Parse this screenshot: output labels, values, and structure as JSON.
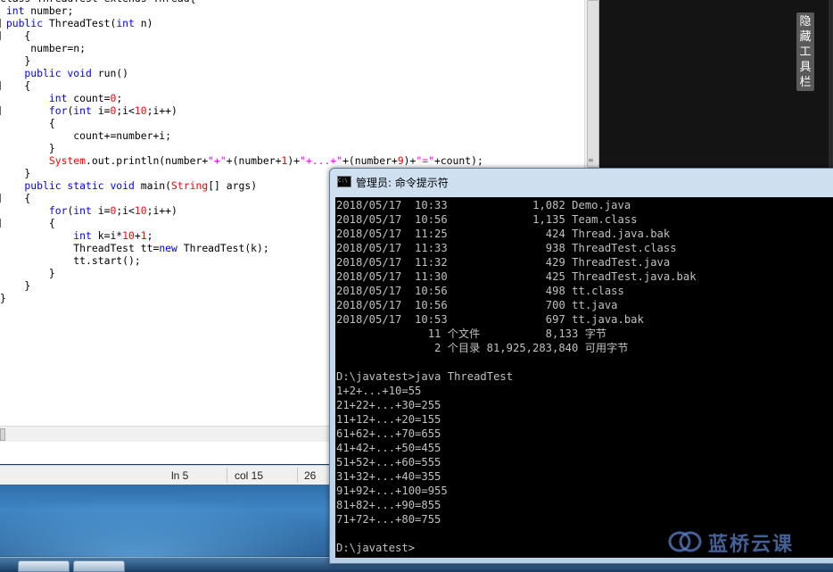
{
  "editor": {
    "lines": [
      [
        {
          "t": "class ThreadTest extends Thread{",
          "c": ""
        }
      ],
      [
        {
          "t": " int",
          "c": "kw"
        },
        {
          "t": " number;",
          "c": ""
        }
      ],
      [
        {
          "t": " public ",
          "c": "kw"
        },
        {
          "t": "ThreadTest(",
          "c": ""
        },
        {
          "t": "int",
          "c": "kw"
        },
        {
          "t": " n)",
          "c": ""
        }
      ],
      [
        {
          "t": "    {",
          "c": ""
        }
      ],
      [
        {
          "t": "     number=n;",
          "c": ""
        }
      ],
      [
        {
          "t": "    }",
          "c": ""
        }
      ],
      [
        {
          "t": "    public void ",
          "c": "kw"
        },
        {
          "t": "run()",
          "c": ""
        }
      ],
      [
        {
          "t": "    {",
          "c": ""
        }
      ],
      [
        {
          "t": "        int",
          "c": "kw"
        },
        {
          "t": " count=",
          "c": ""
        },
        {
          "t": "0",
          "c": "num"
        },
        {
          "t": ";",
          "c": ""
        }
      ],
      [
        {
          "t": "        for",
          "c": "kw"
        },
        {
          "t": "(",
          "c": ""
        },
        {
          "t": "int",
          "c": "kw"
        },
        {
          "t": " i=",
          "c": ""
        },
        {
          "t": "0",
          "c": "num"
        },
        {
          "t": ";i<",
          "c": ""
        },
        {
          "t": "10",
          "c": "num"
        },
        {
          "t": ";i++)",
          "c": ""
        }
      ],
      [
        {
          "t": "        {",
          "c": ""
        }
      ],
      [
        {
          "t": "            count+=number+i;",
          "c": ""
        }
      ],
      [
        {
          "t": "        }",
          "c": ""
        }
      ],
      [
        {
          "t": "        System",
          "c": "sys"
        },
        {
          "t": ".out.println(number+",
          "c": ""
        },
        {
          "t": "\"+\"",
          "c": "str"
        },
        {
          "t": "+(number+",
          "c": ""
        },
        {
          "t": "1",
          "c": "num"
        },
        {
          "t": ")+",
          "c": ""
        },
        {
          "t": "\"+...+\"",
          "c": "str"
        },
        {
          "t": "+(number+",
          "c": ""
        },
        {
          "t": "9",
          "c": "num"
        },
        {
          "t": ")+",
          "c": ""
        },
        {
          "t": "\"=\"",
          "c": "str"
        },
        {
          "t": "+count);",
          "c": ""
        }
      ],
      [
        {
          "t": "    }",
          "c": ""
        }
      ],
      [
        {
          "t": "    public static void ",
          "c": "kw"
        },
        {
          "t": "main(",
          "c": ""
        },
        {
          "t": "String",
          "c": "sys"
        },
        {
          "t": "[] args)",
          "c": ""
        }
      ],
      [
        {
          "t": "    {",
          "c": ""
        }
      ],
      [
        {
          "t": "        for",
          "c": "kw"
        },
        {
          "t": "(",
          "c": ""
        },
        {
          "t": "int",
          "c": "kw"
        },
        {
          "t": " i=",
          "c": ""
        },
        {
          "t": "0",
          "c": "num"
        },
        {
          "t": ";i<",
          "c": ""
        },
        {
          "t": "10",
          "c": "num"
        },
        {
          "t": ";i++)",
          "c": ""
        }
      ],
      [
        {
          "t": "        {",
          "c": ""
        }
      ],
      [
        {
          "t": "            int",
          "c": "kw"
        },
        {
          "t": " k=i*",
          "c": ""
        },
        {
          "t": "10",
          "c": "num"
        },
        {
          "t": "+",
          "c": ""
        },
        {
          "t": "1",
          "c": "num"
        },
        {
          "t": ";",
          "c": ""
        }
      ],
      [
        {
          "t": "            ThreadTest tt=",
          "c": ""
        },
        {
          "t": "new",
          "c": "kw"
        },
        {
          "t": " ThreadTest(k);",
          "c": ""
        }
      ],
      [
        {
          "t": "            tt.start();",
          "c": ""
        }
      ],
      [
        {
          "t": "        }",
          "c": ""
        }
      ],
      [
        {
          "t": "    }",
          "c": ""
        }
      ],
      [
        {
          "t": "}",
          "c": ""
        }
      ]
    ],
    "colors": {
      "keyword": "#0000ff",
      "number": "#ff0000",
      "string": "#ff00ff",
      "system": "#ff0000"
    }
  },
  "statusbar": {
    "ln": "ln 5",
    "col": "col 15",
    "extra": "26"
  },
  "hidebar": {
    "label": "隐藏工具栏"
  },
  "cmd": {
    "title": "管理员: 命令提示符",
    "icon_text": "C:\\",
    "lines": [
      "2018/05/17  10:33             1,082 Demo.java",
      "2018/05/17  10:56             1,135 Team.class",
      "2018/05/17  11:25               424 Thread.java.bak",
      "2018/05/17  11:33               938 ThreadTest.class",
      "2018/05/17  11:32               429 ThreadTest.java",
      "2018/05/17  11:30               425 ThreadTest.java.bak",
      "2018/05/17  10:56               498 tt.class",
      "2018/05/17  10:56               700 tt.java",
      "2018/05/17  10:53               697 tt.java.bak",
      "              11 个文件          8,133 字节",
      "               2 个目录 81,925,283,840 可用字节",
      "",
      "D:\\javatest>java ThreadTest",
      "1+2+...+10=55",
      "21+22+...+30=255",
      "11+12+...+20=155",
      "61+62+...+70=655",
      "41+42+...+50=455",
      "51+52+...+60=555",
      "31+32+...+40=355",
      "91+92+...+100=955",
      "81+82+...+90=855",
      "71+72+...+80=755",
      "",
      "D:\\javatest>"
    ]
  },
  "watermark": {
    "text": "蓝桥云课",
    "icon": "lanqiao-logo-icon"
  },
  "icons": {
    "cmd_icon": "console-icon",
    "grip": "scroll-grip-icon"
  }
}
